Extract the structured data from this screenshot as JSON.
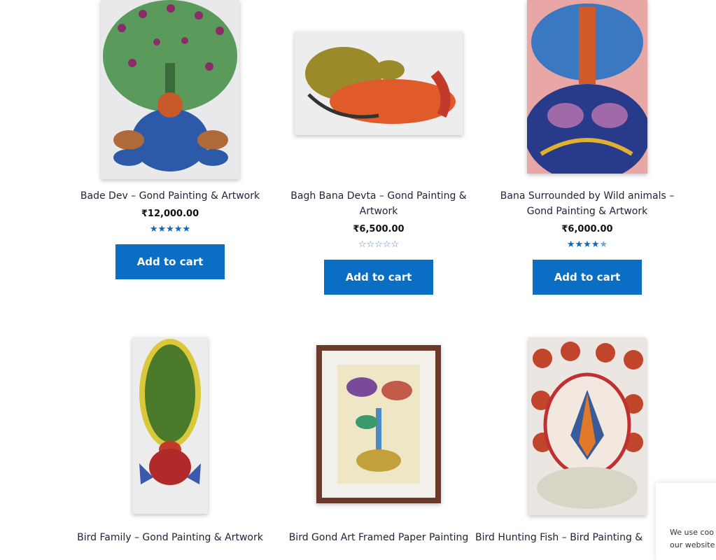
{
  "products": [
    {
      "title": "Bade Dev – Gond Painting & Artwork",
      "price": "₹12,000.00",
      "rating": 5,
      "button": "Add to cart"
    },
    {
      "title": "Bagh Bana Devta – Gond Painting & Artwork",
      "price": "₹6,500.00",
      "rating": 0,
      "button": "Add to cart"
    },
    {
      "title": "Bana Surrounded by Wild animals – Gond Painting & Artwork",
      "price": "₹6,000.00",
      "rating": 4.5,
      "button": "Add to cart"
    },
    {
      "title": "Bird Family – Gond Painting & Artwork"
    },
    {
      "title": "Bird Gond Art Framed Paper Painting"
    },
    {
      "title": "Bird Hunting Fish – Bird Painting & Artwork"
    }
  ],
  "cookie_notice": {
    "line1": "We use coo",
    "line2": "our website"
  },
  "colors": {
    "accent": "#0a6ec5",
    "star": "#1068b8"
  }
}
